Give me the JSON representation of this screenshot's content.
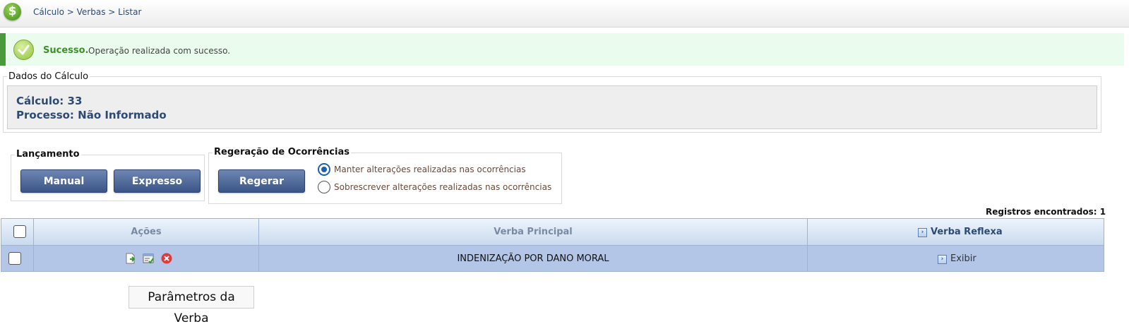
{
  "header": {
    "breadcrumb": "Cálculo > Verbas > Listar",
    "logo_icon": "dollar-icon"
  },
  "success": {
    "title": "Sucesso.",
    "message": "Operação realizada com sucesso."
  },
  "dados": {
    "legend": "Dados do Cálculo",
    "calculo": "Cálculo: 33",
    "processo": "Processo: Não Informado"
  },
  "lancamento": {
    "legend": "Lançamento",
    "manual": "Manual",
    "expresso": "Expresso"
  },
  "regeracao": {
    "legend": "Regeração de Ocorrências",
    "button": "Regerar",
    "options": [
      {
        "label": "Manter alterações realizadas nas ocorrências",
        "selected": true
      },
      {
        "label": "Sobrescrever alterações realizadas nas ocorrências",
        "selected": false
      }
    ]
  },
  "registros": "Registros encontrados: 1",
  "table": {
    "headers": {
      "acoes": "Ações",
      "principal": "Verba Principal",
      "reflexa": "Verba Reflexa"
    },
    "rows": [
      {
        "principal": "INDENIZAÇÃO POR DANO MORAL",
        "reflexa": "Exibir",
        "actions": [
          "add-icon",
          "edit-icon",
          "delete-icon"
        ]
      }
    ]
  },
  "tooltip": "Parâmetros da Verba"
}
